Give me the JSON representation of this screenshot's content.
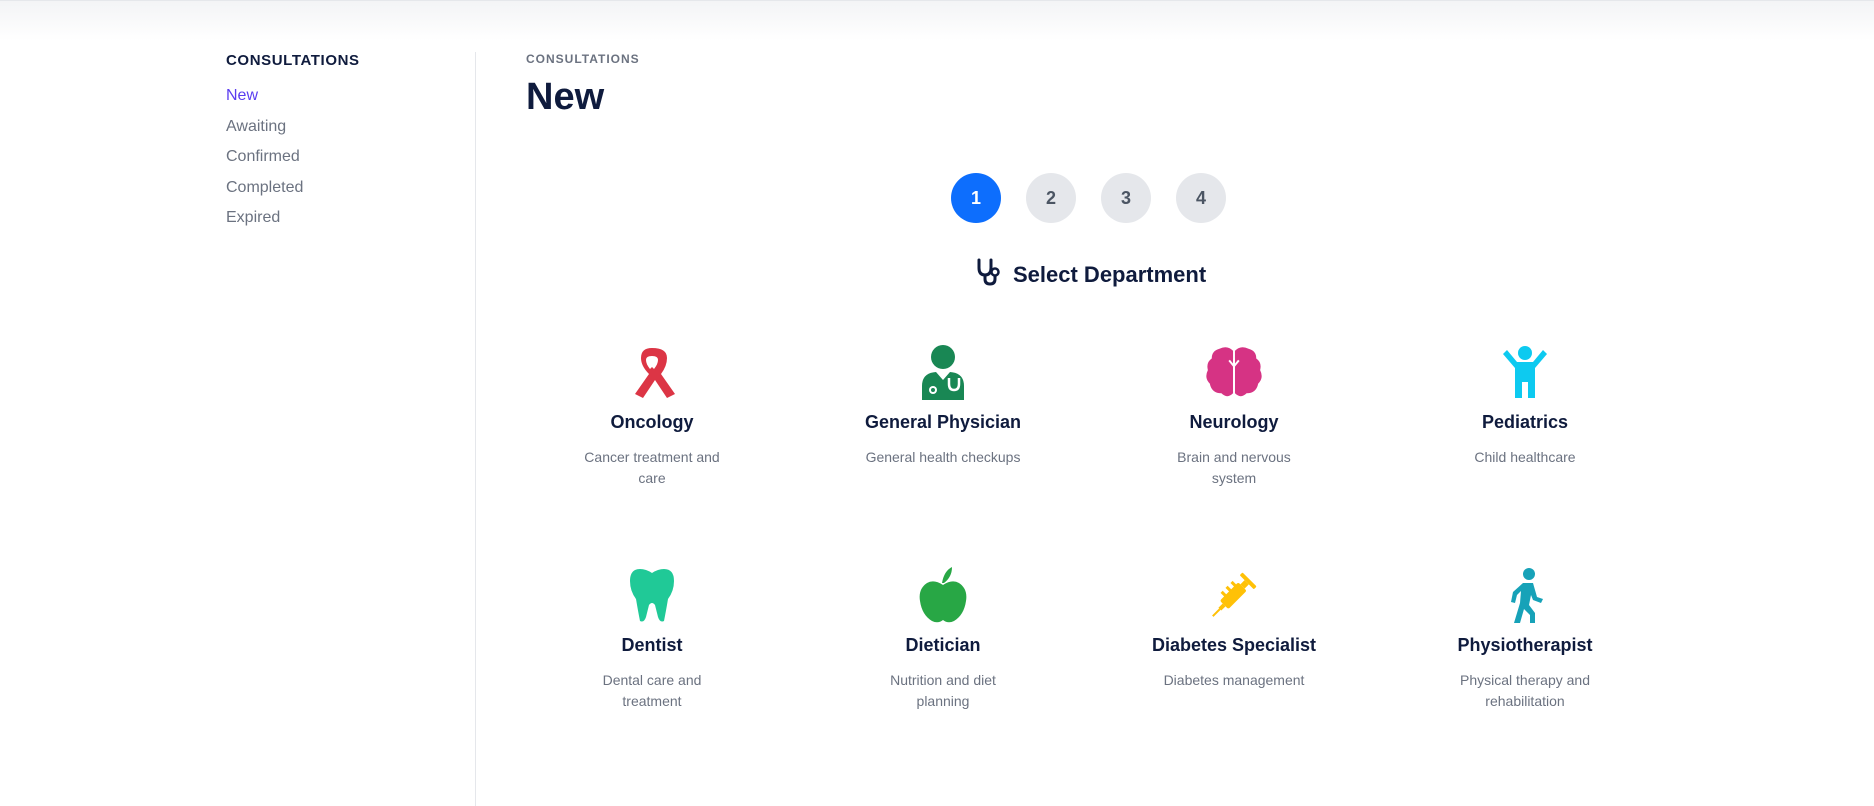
{
  "sidebar": {
    "title": "CONSULTATIONS",
    "items": [
      {
        "label": "New",
        "active": true
      },
      {
        "label": "Awaiting",
        "active": false
      },
      {
        "label": "Confirmed",
        "active": false
      },
      {
        "label": "Completed",
        "active": false
      },
      {
        "label": "Expired",
        "active": false
      }
    ]
  },
  "main": {
    "breadcrumb": "CONSULTATIONS",
    "title": "New"
  },
  "steps": {
    "items": [
      "1",
      "2",
      "3",
      "4"
    ],
    "current": 1
  },
  "section": {
    "icon": "stethoscope-icon",
    "heading": "Select Department"
  },
  "departments": [
    {
      "name": "Oncology",
      "desc": "Cancer treatment and care",
      "icon": "ribbon-icon",
      "color": "#dc3545"
    },
    {
      "name": "General Physician",
      "desc": "General health checkups",
      "icon": "doctor-icon",
      "color": "#198754"
    },
    {
      "name": "Neurology",
      "desc": "Brain and nervous system",
      "icon": "brain-icon",
      "color": "#d63384"
    },
    {
      "name": "Pediatrics",
      "desc": "Child healthcare",
      "icon": "child-icon",
      "color": "#0dcaf0"
    },
    {
      "name": "Dentist",
      "desc": "Dental care and treatment",
      "icon": "tooth-icon",
      "color": "#20c997"
    },
    {
      "name": "Dietician",
      "desc": "Nutrition and diet planning",
      "icon": "apple-icon",
      "color": "#28a745"
    },
    {
      "name": "Diabetes Specialist",
      "desc": "Diabetes management",
      "icon": "syringe-icon",
      "color": "#ffc107"
    },
    {
      "name": "Physiotherapist",
      "desc": "Physical therapy and rehabilitation",
      "icon": "walking-icon",
      "color": "#17a2b8"
    }
  ],
  "colors": {
    "accent": "#5b3df0",
    "step_active": "#0d6efd",
    "step_inactive": "#e5e7eb",
    "heading": "#0f1b3d",
    "muted": "#6b7280"
  }
}
